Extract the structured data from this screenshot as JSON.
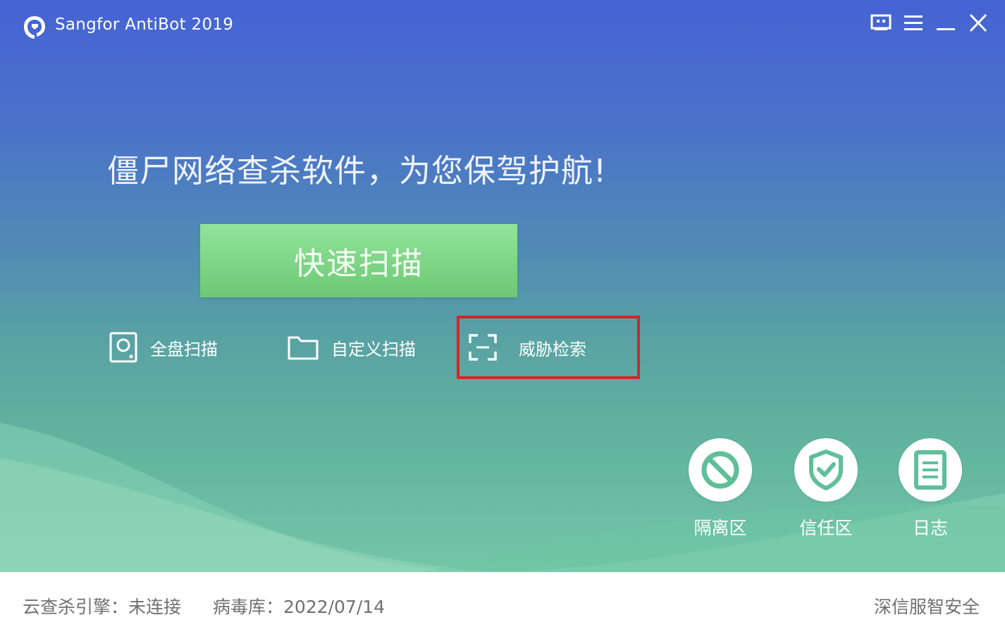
{
  "app": {
    "title": "Sangfor AntiBot 2019"
  },
  "colors": {
    "gradient_top": "#4563d3",
    "gradient_bottom": "#74c6a9",
    "scan_button": "#7ed584",
    "highlight": "#d62626",
    "tool_icon": "#5fbf9a"
  },
  "window_controls": [
    {
      "name": "skin-icon"
    },
    {
      "name": "menu-icon"
    },
    {
      "name": "minimize-icon"
    },
    {
      "name": "close-icon"
    }
  ],
  "main": {
    "slogan": "僵尸网络查杀软件，为您保驾护航!",
    "quick_scan_label": "快速扫描",
    "scan_options": [
      {
        "label": "全盘扫描",
        "icon": "disk-icon"
      },
      {
        "label": "自定义扫描",
        "icon": "folder-icon"
      },
      {
        "label": "威胁检索",
        "icon": "scan-frame-icon",
        "highlighted": true
      }
    ],
    "tools": [
      {
        "label": "隔离区",
        "icon": "ban-icon"
      },
      {
        "label": "信任区",
        "icon": "shield-check-icon"
      },
      {
        "label": "日志",
        "icon": "log-icon"
      }
    ]
  },
  "status": {
    "engine_label": "云查杀引擎：",
    "engine_value": "未连接",
    "db_label": "病毒库：",
    "db_value": "2022/07/14",
    "brand": "深信服智安全"
  }
}
